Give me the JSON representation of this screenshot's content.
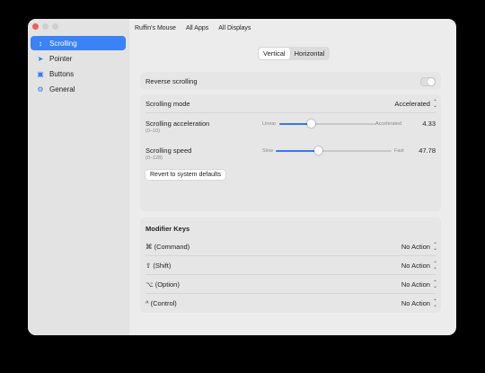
{
  "sidebar": {
    "items": [
      {
        "label": "Scrolling",
        "icon": "scroll-arrows-icon",
        "active": true
      },
      {
        "label": "Pointer",
        "icon": "pointer-icon",
        "active": false
      },
      {
        "label": "Buttons",
        "icon": "buttons-icon",
        "active": false
      },
      {
        "label": "General",
        "icon": "gear-icon",
        "active": false
      }
    ]
  },
  "toolbar": {
    "device": "Ruffin's Mouse",
    "all_apps": "All Apps",
    "all_displays": "All Displays"
  },
  "orientation": {
    "vertical": "Vertical",
    "horizontal": "Horizontal",
    "selected": "Vertical"
  },
  "scrolling": {
    "reverse_label": "Reverse scrolling",
    "reverse_enabled": false,
    "mode_label": "Scrolling mode",
    "mode_value": "Accelerated",
    "acceleration": {
      "label": "Scrolling acceleration",
      "range": "(0–10)",
      "min_label": "Linear",
      "max_label": "Accelerated",
      "value": "4.33",
      "fraction": 0.33
    },
    "speed": {
      "label": "Scrolling speed",
      "range": "(0–128)",
      "min_label": "Slow",
      "max_label": "Fast",
      "value": "47.78",
      "fraction": 0.37
    },
    "revert_label": "Revert to system defaults"
  },
  "modifier_keys": {
    "title": "Modifier Keys",
    "rows": [
      {
        "label": "⌘ (Command)",
        "value": "No Action"
      },
      {
        "label": "⇧ (Shift)",
        "value": "No Action"
      },
      {
        "label": "⌥ (Option)",
        "value": "No Action"
      },
      {
        "label": "^ (Control)",
        "value": "No Action"
      }
    ]
  },
  "colors": {
    "accent": "#3478f6",
    "close": "#ec5f57"
  }
}
